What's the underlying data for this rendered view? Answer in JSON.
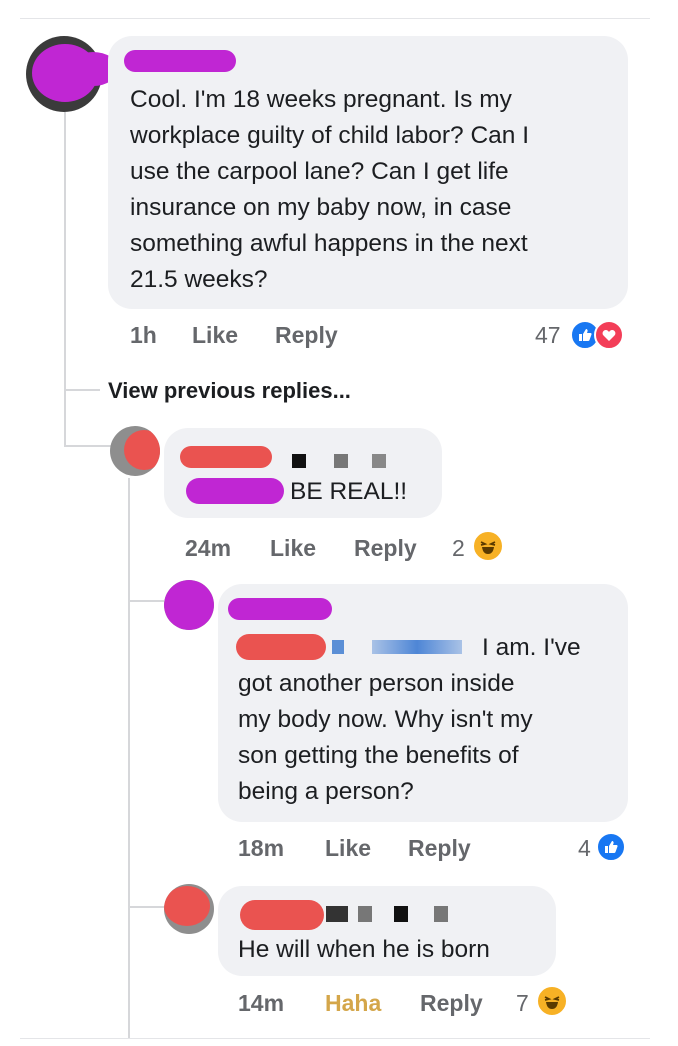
{
  "comments": [
    {
      "text_lines": [
        "Cool. I'm 18 weeks pregnant. Is my",
        "workplace guilty of child labor? Can I",
        "use the carpool lane? Can I get life",
        "insurance on my baby now, in case",
        "something awful happens in the next",
        "21.5 weeks?"
      ],
      "time": "1h",
      "like_label": "Like",
      "reply_label": "Reply",
      "reaction_count": "47",
      "reactions": [
        "like-icon",
        "love-icon"
      ]
    }
  ],
  "view_previous": "View previous replies...",
  "replies": [
    {
      "text_lines": [
        "BE REAL!!"
      ],
      "time": "24m",
      "like_label": "Like",
      "reply_label": "Reply",
      "reaction_count": "2",
      "reactions": [
        "haha-icon"
      ]
    },
    {
      "text_lines": [
        "I am. I've",
        "got another person inside",
        "my body now. Why isn't my",
        "son getting the benefits of",
        "being a person?"
      ],
      "time": "18m",
      "like_label": "Like",
      "reply_label": "Reply",
      "reaction_count": "4",
      "reactions": [
        "like-icon"
      ]
    },
    {
      "text_lines": [
        "He will when he is born"
      ],
      "time": "14m",
      "like_label": "Haha",
      "reply_label": "Reply",
      "reaction_count": "7",
      "reactions": [
        "haha-icon"
      ]
    }
  ],
  "colors": {
    "bubble": "#f0f1f4",
    "meta_text": "#65676b",
    "haha_active": "#d4a64a",
    "like_blue": "#1877f2",
    "love_red": "#f33e58",
    "redact_purple": "#c026d3",
    "redact_red": "#ea5350"
  }
}
